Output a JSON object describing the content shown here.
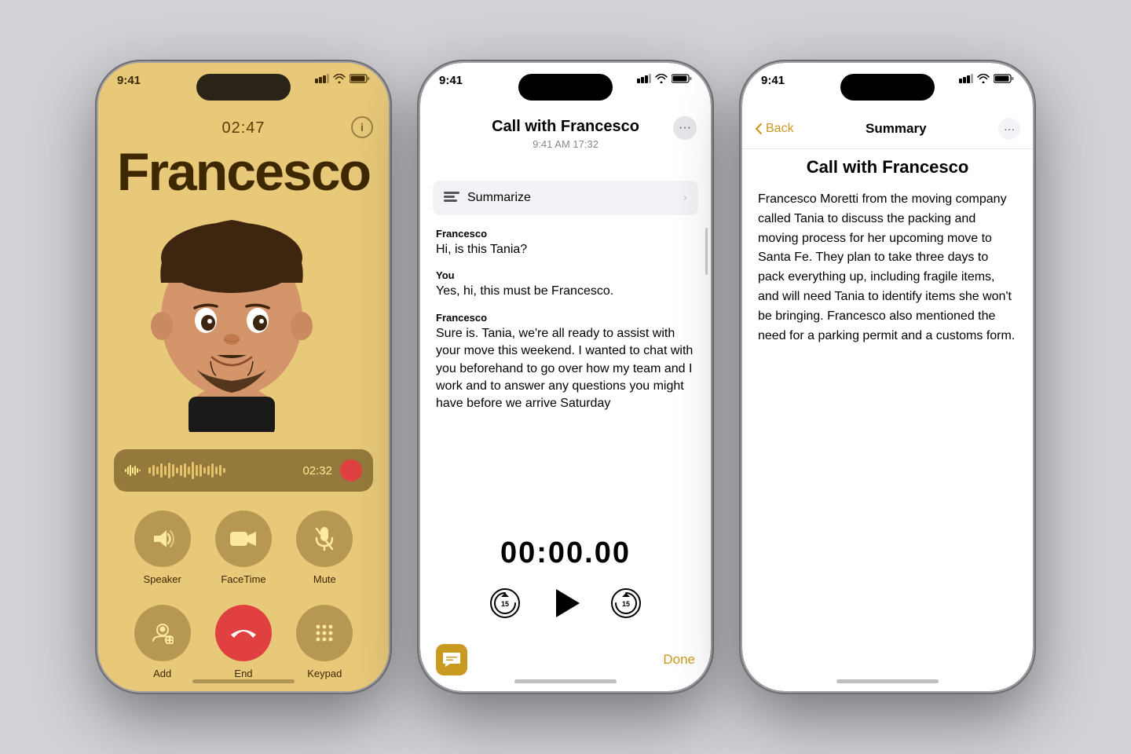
{
  "background_color": "#d1d1d6",
  "phone1": {
    "status_time": "9:41",
    "call_duration_display": "02:47",
    "caller_name": "Francesco",
    "recording_time": "02:32",
    "buttons_row1": [
      {
        "id": "speaker",
        "label": "Speaker"
      },
      {
        "id": "facetime",
        "label": "FaceTime"
      },
      {
        "id": "mute",
        "label": "Mute"
      }
    ],
    "buttons_row2": [
      {
        "id": "add",
        "label": "Add"
      },
      {
        "id": "end",
        "label": "End"
      },
      {
        "id": "keypad",
        "label": "Keypad"
      }
    ]
  },
  "phone2": {
    "status_time": "9:41",
    "title": "Call with Francesco",
    "subtitle": "9:41 AM  17:32",
    "summarize_label": "Summarize",
    "transcript": [
      {
        "speaker": "Francesco",
        "text": "Hi, is this Tania?"
      },
      {
        "speaker": "You",
        "text": "Yes, hi, this must be Francesco."
      },
      {
        "speaker": "Francesco",
        "text": "Sure is. Tania, we're all ready to assist with your move this weekend. I wanted to chat with you beforehand to go over how my team and I work and to answer any questions you might have before we arrive Saturday"
      }
    ],
    "playback_time": "00:00.00",
    "done_label": "Done"
  },
  "phone3": {
    "status_time": "9:41",
    "back_label": "Back",
    "nav_title": "Summary",
    "call_title": "Call with Francesco",
    "summary_text": "Francesco Moretti from the moving company called Tania to discuss the packing and moving process for her upcoming move to Santa Fe. They plan to take three days to pack everything up, including fragile items, and will need Tania to identify items she won't be bringing. Francesco also mentioned the need for a parking permit and a customs form."
  },
  "icons": {
    "signal": "▐▐▐",
    "wifi": "wifi",
    "battery": "battery"
  }
}
